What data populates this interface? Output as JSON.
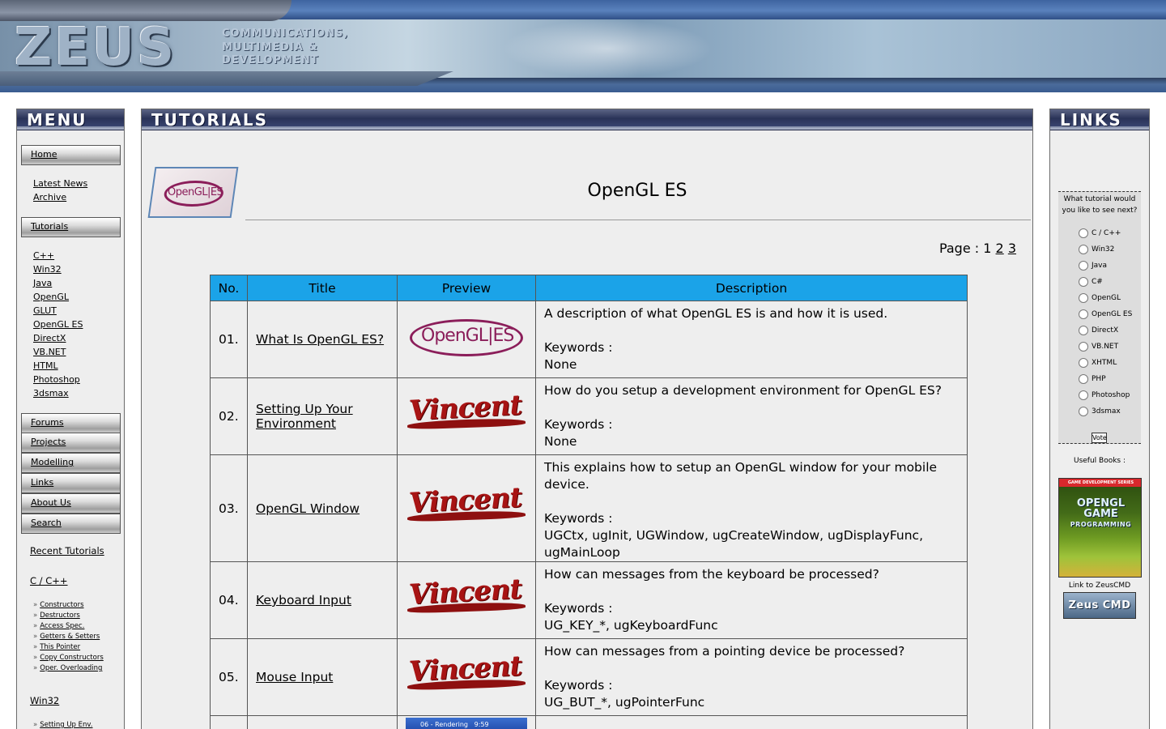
{
  "banner": {
    "logo": "ZEUS",
    "tagline": [
      "Communications,",
      "Multimedia &",
      "Development"
    ]
  },
  "menu": {
    "header": "Menu",
    "home": "Home",
    "home_links": [
      "Latest News",
      "Archive"
    ],
    "tutorials": "Tutorials",
    "tutorial_links": [
      "C++",
      "Win32",
      "Java",
      "OpenGL",
      "GLUT",
      "OpenGL ES",
      "DirectX",
      "VB.NET",
      "HTML",
      "Photoshop",
      "3dsmax"
    ],
    "buttons": [
      "Forums",
      "Projects",
      "Modelling",
      "Links",
      "About Us",
      "Search"
    ],
    "recent": "Recent Tutorials",
    "cpp_section": "C / C++",
    "cpp_links": [
      "Constructors",
      "Destructors",
      "Access Spec.",
      "Getters & Setters",
      "This Pointer",
      "Copy Constructors",
      "Oper. Overloading"
    ],
    "win32_section": "Win32",
    "win32_links": [
      "Setting Up Env."
    ]
  },
  "center": {
    "header": "Tutorials",
    "page_title": "OpenGL ES",
    "logo_text": "OpenGL|ES",
    "pager": {
      "label": "Page :",
      "pages": [
        "1",
        "2",
        "3"
      ]
    },
    "columns": [
      "No.",
      "Title",
      "Preview",
      "Description"
    ],
    "keywords_label": "Keywords :",
    "rows": [
      {
        "no": "01.",
        "title": "What Is OpenGL ES?",
        "preview": "OpenGL|ES",
        "desc": "A description of what OpenGL ES is and how it is used.",
        "keywords": "None"
      },
      {
        "no": "02.",
        "title": "Setting Up Your Environment",
        "preview": "Vincent",
        "desc": "How do you setup a development environment for OpenGL ES?",
        "keywords": "None"
      },
      {
        "no": "03.",
        "title": "OpenGL Window",
        "preview": "Vincent",
        "desc": "This explains how to setup an OpenGL window for your mobile device.",
        "keywords": "UGCtx, ugInit, UGWindow, ugCreateWindow, ugDisplayFunc, ugMainLoop"
      },
      {
        "no": "04.",
        "title": "Keyboard Input",
        "preview": "Vincent",
        "desc": "How can messages from the keyboard be processed?",
        "keywords": "UG_KEY_*, ugKeyboardFunc"
      },
      {
        "no": "05.",
        "title": "Mouse Input",
        "preview": "Vincent",
        "desc": "How can messages from a pointing device be processed?",
        "keywords": "UG_BUT_*, ugPointerFunc"
      }
    ],
    "partial_preview": "06 - Rendering",
    "partial_clock": "9:59"
  },
  "links": {
    "header": "Links",
    "poll_question": "What tutorial would you like to see next?",
    "poll_options": [
      "C / C++",
      "Win32",
      "Java",
      "C#",
      "OpenGL",
      "OpenGL ES",
      "DirectX",
      "VB.NET",
      "XHTML",
      "PHP",
      "Photoshop",
      "3dsmax"
    ],
    "vote": "Vote",
    "useful_books": "Useful Books :",
    "book_series": "GAME DEVELOPMENT SERIES",
    "book_title": "OPENGL GAME",
    "book_sub": "PROGRAMMING",
    "link_to": "Link to ZeusCMD",
    "badge": "Zeus CMD"
  }
}
